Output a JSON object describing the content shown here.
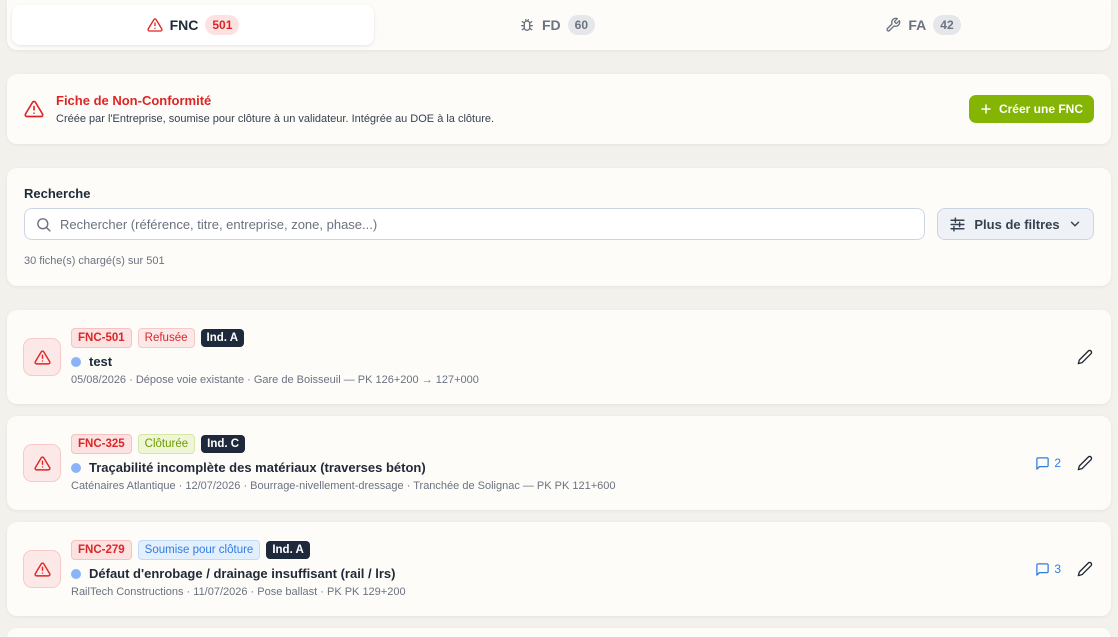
{
  "tabs": [
    {
      "label": "FNC",
      "count": "501",
      "icon": "warning-triangle-icon"
    },
    {
      "label": "FD",
      "count": "60",
      "icon": "bug-icon"
    },
    {
      "label": "FA",
      "count": "42",
      "icon": "wrench-icon"
    }
  ],
  "header": {
    "title": "Fiche de Non-Conformité",
    "description": "Créée par l'Entreprise, soumise pour clôture à un validateur. Intégrée au DOE à la clôture.",
    "create_label": "Créer une FNC"
  },
  "search": {
    "label": "Recherche",
    "placeholder": "Rechercher (référence, titre, entreprise, zone, phase...)",
    "filters_label": "Plus de filtres",
    "count_text": "30 fiche(s) chargé(s) sur 501"
  },
  "items": [
    {
      "ref": "FNC-501",
      "status": "Refusée",
      "ind": "Ind. A",
      "title": "test",
      "meta": "05/08/2026 · Dépose voie existante · Gare de Boisseuil — PK 126+200 → 127+000",
      "comments": ""
    },
    {
      "ref": "FNC-325",
      "status": "Clôturée",
      "ind": "Ind. C",
      "title": "Traçabilité incomplète des matériaux (traverses béton)",
      "meta": "Caténaires Atlantique · 12/07/2026 · Bourrage-nivellement-dressage · Tranchée de Solignac — PK PK 121+600",
      "comments": "2"
    },
    {
      "ref": "FNC-279",
      "status": "Soumise pour clôture",
      "ind": "Ind. A",
      "title": "Défaut d'enrobage / drainage insuffisant (rail / lrs)",
      "meta": "RailTech Constructions · 11/07/2026 · Pose ballast · PK PK 129+200",
      "comments": "3"
    }
  ],
  "colors": {
    "accent_red": "#dc2626",
    "create_green": "#84b404",
    "status_closed": "#6d9b00",
    "status_submitted": "#2f7de1"
  }
}
